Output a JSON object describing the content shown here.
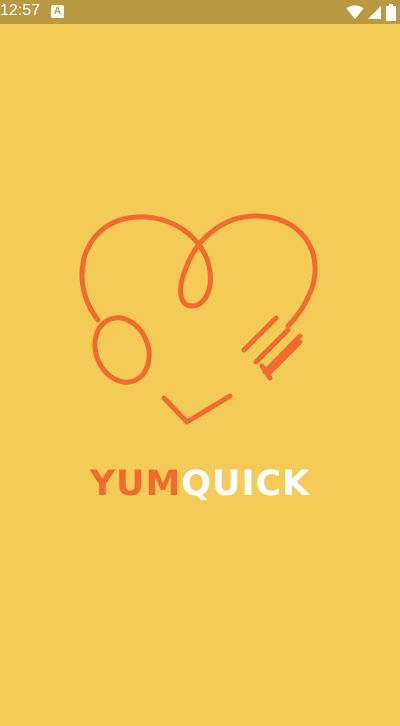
{
  "status_bar": {
    "time": "12:57",
    "notification_badge": "A",
    "icons": [
      "wifi-icon",
      "signal-icon",
      "battery-icon"
    ]
  },
  "brand": {
    "part1": "YUM",
    "part2": "QUICK"
  },
  "colors": {
    "background": "#F5CB58",
    "status_bar": "#B99A43",
    "accent": "#F26A2E",
    "white": "#FFFFFF"
  },
  "logo_icon": "heart-fork-spoon-smile-icon"
}
